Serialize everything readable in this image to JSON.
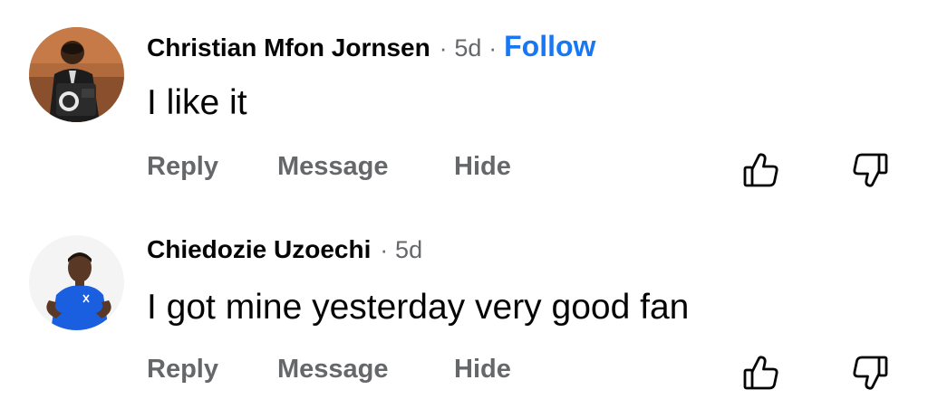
{
  "comments": [
    {
      "author": "Christian Mfon Jornsen",
      "separator": "·",
      "time": "5d",
      "follow_label": "Follow",
      "text": "I like it",
      "actions": {
        "reply": "Reply",
        "message": "Message",
        "hide": "Hide"
      },
      "icons": {
        "upvote": "thumbs-up-outline-icon",
        "downvote": "thumbs-down-outline-icon"
      }
    },
    {
      "author": "Chiedozie Uzoechi",
      "separator": "·",
      "time": "5d",
      "text": "I got mine yesterday very good fan",
      "actions": {
        "reply": "Reply",
        "message": "Message",
        "hide": "Hide"
      },
      "icons": {
        "upvote": "thumbs-up-outline-icon",
        "downvote": "thumbs-down-outline-icon"
      }
    }
  ],
  "colors": {
    "text_primary": "#050505",
    "text_secondary": "#65676b",
    "follow_accent": "#1877f2",
    "background": "#ffffff"
  }
}
